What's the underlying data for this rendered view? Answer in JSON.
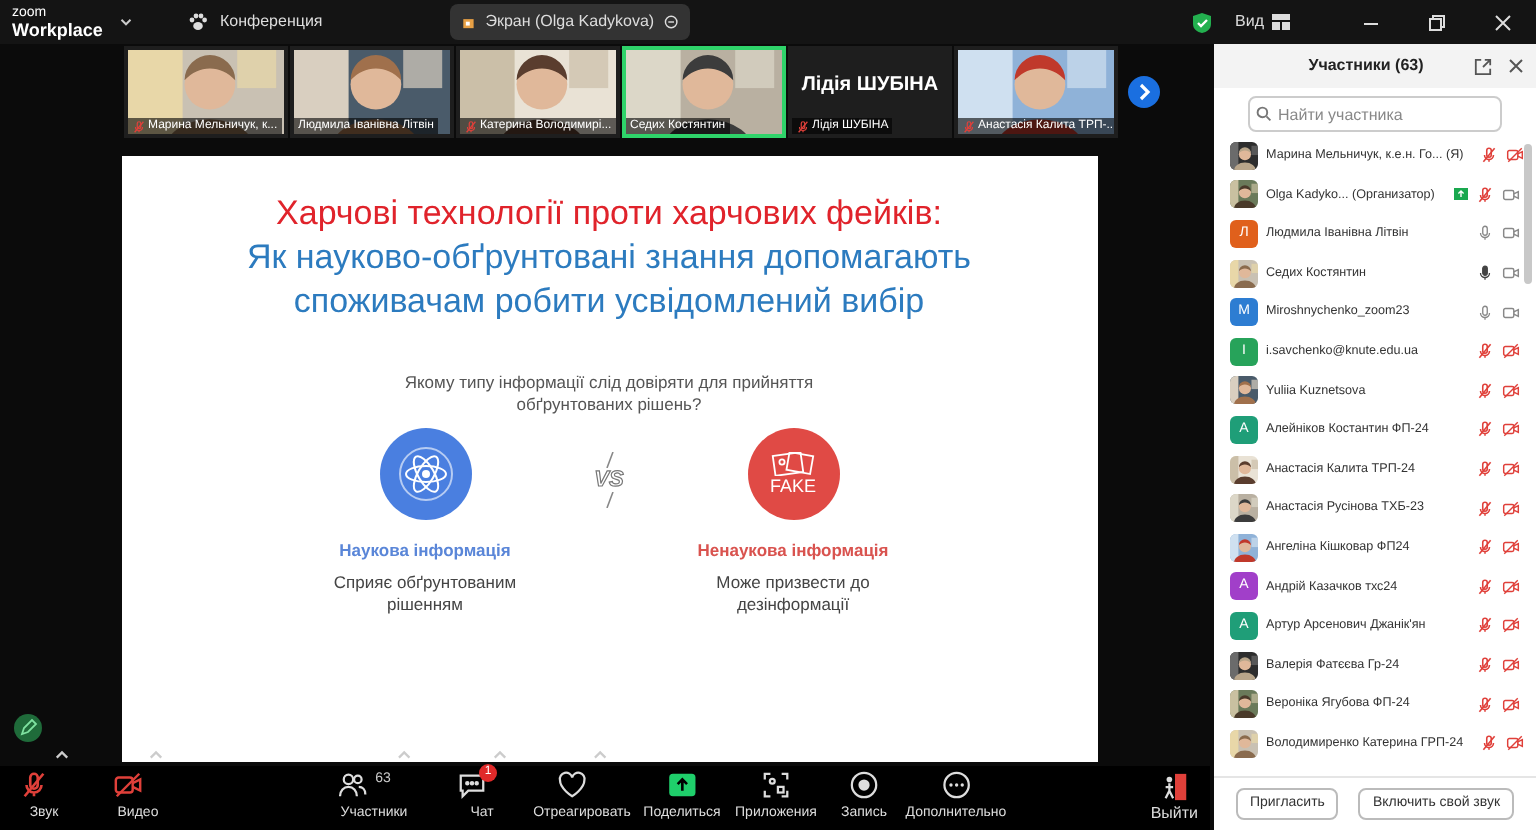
{
  "app": {
    "logo_top": "zoom",
    "logo_bottom": "Workplace",
    "meeting": "Конференция",
    "share_pill": "Экран (Olga Kadykova)",
    "view": "Вид"
  },
  "video_strip": [
    {
      "kind": "picture",
      "name": "Марина Мельничук, к...",
      "muted": true,
      "speaking": false
    },
    {
      "kind": "picture",
      "name": "Людмила Іванівна Літвін",
      "muted": false,
      "speaking": false
    },
    {
      "kind": "picture",
      "name": "Катерина Володимирі...",
      "muted": true,
      "speaking": false
    },
    {
      "kind": "picture",
      "name": "Седих Костянтин",
      "muted": false,
      "speaking": true
    },
    {
      "kind": "name",
      "title": "Лідія ШУБІНА",
      "name": "Лідія ШУБІНА",
      "muted": true,
      "speaking": false
    },
    {
      "kind": "picture",
      "name": "Анастасія Калита ТРП-...",
      "muted": true,
      "speaking": false
    }
  ],
  "slide": {
    "title_red": "Харчові технології проти харчових фейків:",
    "title_blue": [
      "Як науково-обґрунтовані знання допомагають",
      "споживачам робити усвідомлений вибір"
    ],
    "question": "Якому типу інформації слід довіряти для прийняття обґрунтованих рішень?",
    "vs": "VS",
    "options": [
      {
        "kind": "science",
        "label": "Наукова інформація",
        "text": "Сприяє обґрунтованим рішенням"
      },
      {
        "kind": "fake",
        "badge": "FAKE",
        "label": "Ненаукова інформація",
        "text": "Може призвести до дезінформації"
      }
    ]
  },
  "toolbar": [
    {
      "kind": "audio",
      "label": "Звук",
      "off": true,
      "caret": true
    },
    {
      "kind": "video",
      "label": "Видео",
      "off": true,
      "caret": true
    },
    {
      "kind": "participants",
      "label": "Участники",
      "count": "63",
      "caret": true
    },
    {
      "kind": "chat",
      "label": "Чат",
      "badge": "1",
      "caret": true
    },
    {
      "kind": "react",
      "label": "Отреагировать",
      "caret": true
    },
    {
      "kind": "share",
      "label": "Поделиться"
    },
    {
      "kind": "apps",
      "label": "Приложения"
    },
    {
      "kind": "record",
      "label": "Запись"
    },
    {
      "kind": "more",
      "label": "Дополнительно"
    }
  ],
  "leave": {
    "label": "Выйти"
  },
  "participants_panel": {
    "title": "Участники (63)",
    "search": {
      "placeholder": "Найти участника"
    },
    "items": [
      {
        "kind": "picture",
        "name": "Марина Мельничук, к.е.н. Го... (Я)",
        "muted": true,
        "video": false
      },
      {
        "kind": "picture",
        "name": "Olga Kadyko... (Организатор)",
        "sharing": true,
        "muted": true,
        "video": true
      },
      {
        "kind": "letter",
        "letter": "Л",
        "color": "#e0601c",
        "name": "Людмила Іванівна Літвін",
        "muted": false,
        "speaking": false,
        "video": true
      },
      {
        "kind": "picture",
        "name": "Седих Костянтин",
        "muted": false,
        "speaking": true,
        "video": true
      },
      {
        "kind": "letter",
        "letter": "M",
        "color": "#2d7dd2",
        "name": "Miroshnychenko_zoom23",
        "muted": false,
        "speaking": false,
        "video": true
      },
      {
        "kind": "letter",
        "letter": "I",
        "color": "#27a35a",
        "name": "i.savchenko@knute.edu.ua",
        "muted": true,
        "video": false
      },
      {
        "kind": "picture",
        "name": "Yuliia Kuznetsova",
        "muted": true,
        "video": false
      },
      {
        "kind": "letter",
        "letter": "А",
        "color": "#1f9e78",
        "name": "Алейніков Костантин ФП-24",
        "muted": true,
        "video": false
      },
      {
        "kind": "picture",
        "name": "Анастасія Калита ТРП-24",
        "muted": true,
        "video": false
      },
      {
        "kind": "picture",
        "name": "Анастасія Русінова ТХБ-23",
        "muted": true,
        "video": false
      },
      {
        "kind": "picture",
        "name": "Ангеліна Кішковар ФП24",
        "muted": true,
        "video": false
      },
      {
        "kind": "letter",
        "letter": "А",
        "color": "#a13fc9",
        "name": "Андрій Казачков тхс24",
        "muted": true,
        "video": false
      },
      {
        "kind": "letter",
        "letter": "А",
        "color": "#1f9e78",
        "name": "Артур Арсенович Джанік'ян",
        "muted": true,
        "video": false
      },
      {
        "kind": "picture",
        "name": "Валерія Фатєєва Гр-24",
        "muted": true,
        "video": false
      },
      {
        "kind": "picture",
        "name": "Вероніка Ягубова ФП-24",
        "muted": true,
        "video": false
      },
      {
        "kind": "picture",
        "name": "Володимиренко Катерина ГРП-24",
        "muted": true,
        "video": false
      }
    ],
    "buttons": [
      "Пригласить",
      "Включить свой звук"
    ]
  }
}
